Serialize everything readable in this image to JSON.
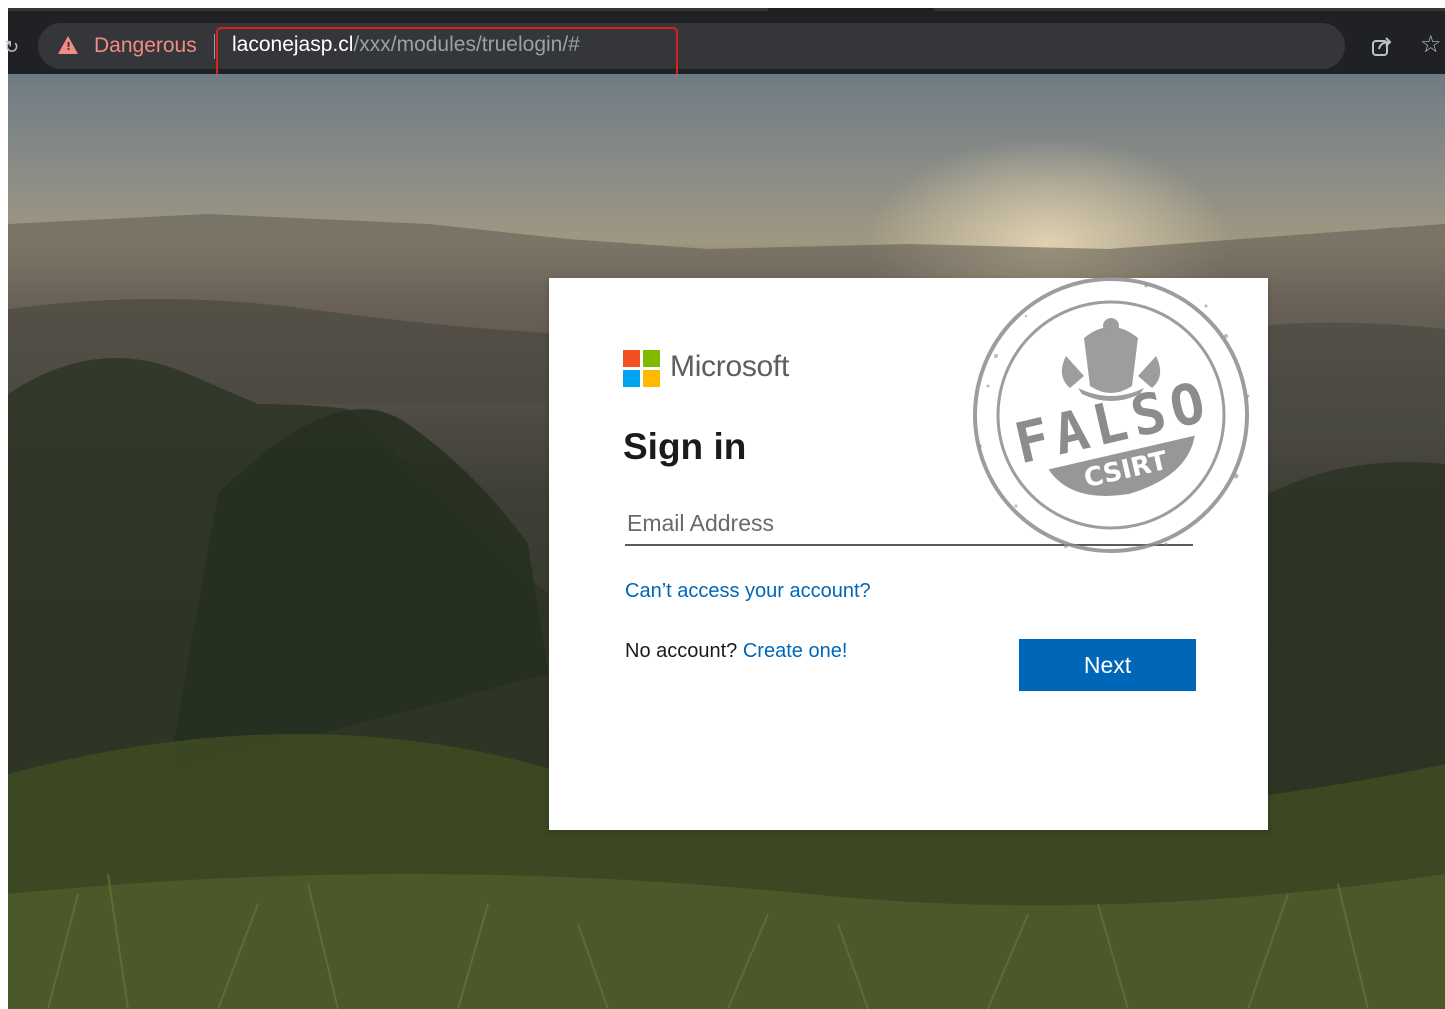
{
  "browser": {
    "security_label": "Dangerous",
    "url_host": "laconejasp.cl",
    "url_path": "/xxx/modules/truelogin/#",
    "icons": {
      "security": "warning-triangle-icon",
      "share": "share-icon",
      "bookmark": "star-icon"
    },
    "colors": {
      "danger": "#f28b82",
      "highlight_box": "#d92020"
    }
  },
  "signin": {
    "brand_name": "Microsoft",
    "title": "Sign in",
    "email_placeholder": "Email Address",
    "email_value": "",
    "cant_access_link": "Can’t access your account?",
    "no_account_text": "No account?",
    "create_link": "Create one!",
    "next_button": "Next",
    "colors": {
      "accent": "#0067b8",
      "logo_red": "#f25022",
      "logo_green": "#7fba00",
      "logo_blue": "#00a4ef",
      "logo_yellow": "#ffb900"
    }
  },
  "stamp": {
    "main_text": "FALSO",
    "badge_text": "CSIRT",
    "color": "#8c8c8c"
  }
}
